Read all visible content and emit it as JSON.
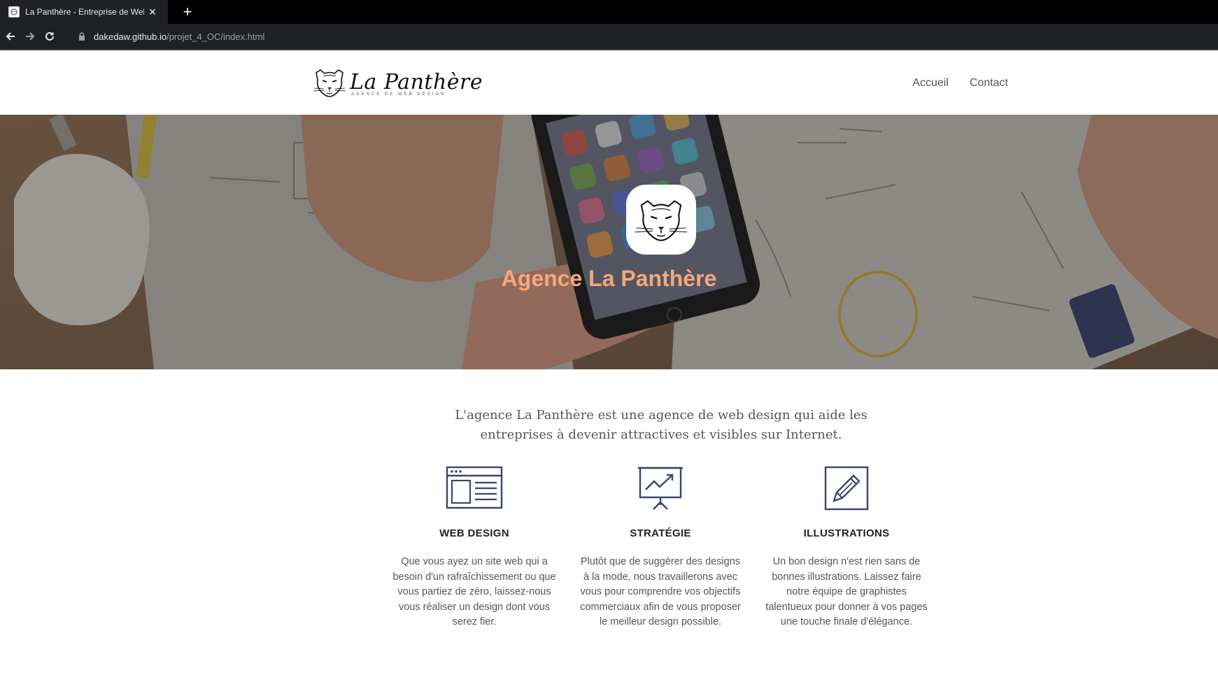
{
  "browser": {
    "tab_title": "La Panthère - Entreprise de Web",
    "url_host": "dakedaw.github.io",
    "url_path": "/projet_4_OC/index.html"
  },
  "header": {
    "logo_name": "La Panthère",
    "logo_tagline": "AGENCE DE WEB DESIGN",
    "nav": [
      "Accueil",
      "Contact"
    ]
  },
  "hero": {
    "title": "Agence La Panthère"
  },
  "intro": {
    "text": "L'agence La Panthère est une agence de web design qui aide les entreprises à devenir attractives et visibles sur Internet."
  },
  "services": [
    {
      "icon": "web-layout-icon",
      "title": "WEB DESIGN",
      "text": "Que vous ayez un site web qui a besoin d'un rafraîchissement ou que vous partiez de zéro, laissez-nous vous réaliser un design dont vous serez fier."
    },
    {
      "icon": "presentation-chart-icon",
      "title": "STRATÉGIE",
      "text": "Plutôt que de suggérer des designs à la mode, nous travaillerons avec vous pour comprendre vos objectifs commerciaux afin de vous proposer le meilleur design possible."
    },
    {
      "icon": "pencil-icon",
      "title": "ILLUSTRATIONS",
      "text": "Un bon design n'est rien sans de bonnes illustrations. Laissez faire notre équipe de graphistes talentueux pour donner à vos pages une touche finale d'élégance."
    }
  ],
  "colors": {
    "hero_title": "#f5a77a",
    "icon_stroke": "#3a4470",
    "text_gray": "#555555"
  }
}
